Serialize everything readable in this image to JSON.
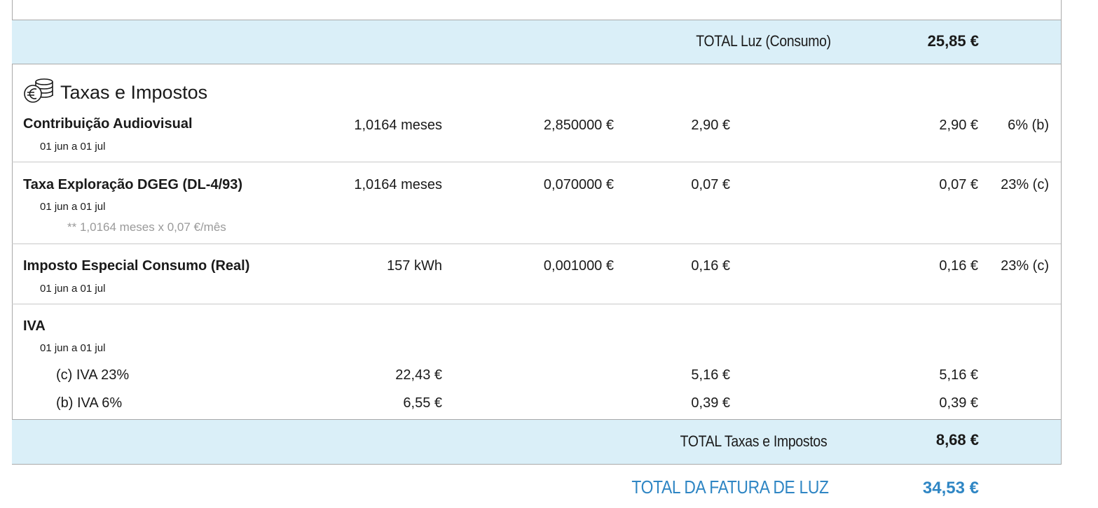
{
  "luz_total": {
    "label": "TOTAL Luz (Consumo)",
    "value": "25,85 €"
  },
  "section": {
    "title": "Taxas e Impostos",
    "icon": "euro-coins-icon"
  },
  "rows": [
    {
      "name": "Contribuição Audiovisual",
      "period": "01 jun a 01 jul",
      "qty": "1,0164 meses",
      "unit_price": "2,850000 €",
      "amount": "2,90 €",
      "total": "2,90 €",
      "vat": "6% (b)"
    },
    {
      "name": "Taxa Exploração DGEG (DL-4/93)",
      "period": "01 jun a 01 jul",
      "note": "** 1,0164 meses x 0,07 €/mês",
      "qty": "1,0164 meses",
      "unit_price": "0,070000 €",
      "amount": "0,07 €",
      "total": "0,07 €",
      "vat": "23% (c)"
    },
    {
      "name": "Imposto Especial Consumo (Real)",
      "period": "01 jun a 01 jul",
      "qty": "157 kWh",
      "unit_price": "0,001000 €",
      "amount": "0,16 €",
      "total": "0,16 €",
      "vat": "23% (c)"
    }
  ],
  "iva": {
    "name": "IVA",
    "period": "01 jun a 01 jul",
    "lines": [
      {
        "label": "(c) IVA 23%",
        "base": "22,43 €",
        "amount": "5,16 €",
        "total": "5,16 €"
      },
      {
        "label": "(b) IVA 6%",
        "base": "6,55 €",
        "amount": "0,39 €",
        "total": "0,39 €"
      }
    ]
  },
  "taxes_total": {
    "label": "TOTAL Taxas e Impostos",
    "value": "8,68 €"
  },
  "grand_total": {
    "label": "TOTAL DA FATURA DE LUZ",
    "value": "34,53 €",
    "color": "#2f86c4"
  },
  "colors": {
    "band": "#daeff8",
    "border": "#a9a9a9"
  }
}
